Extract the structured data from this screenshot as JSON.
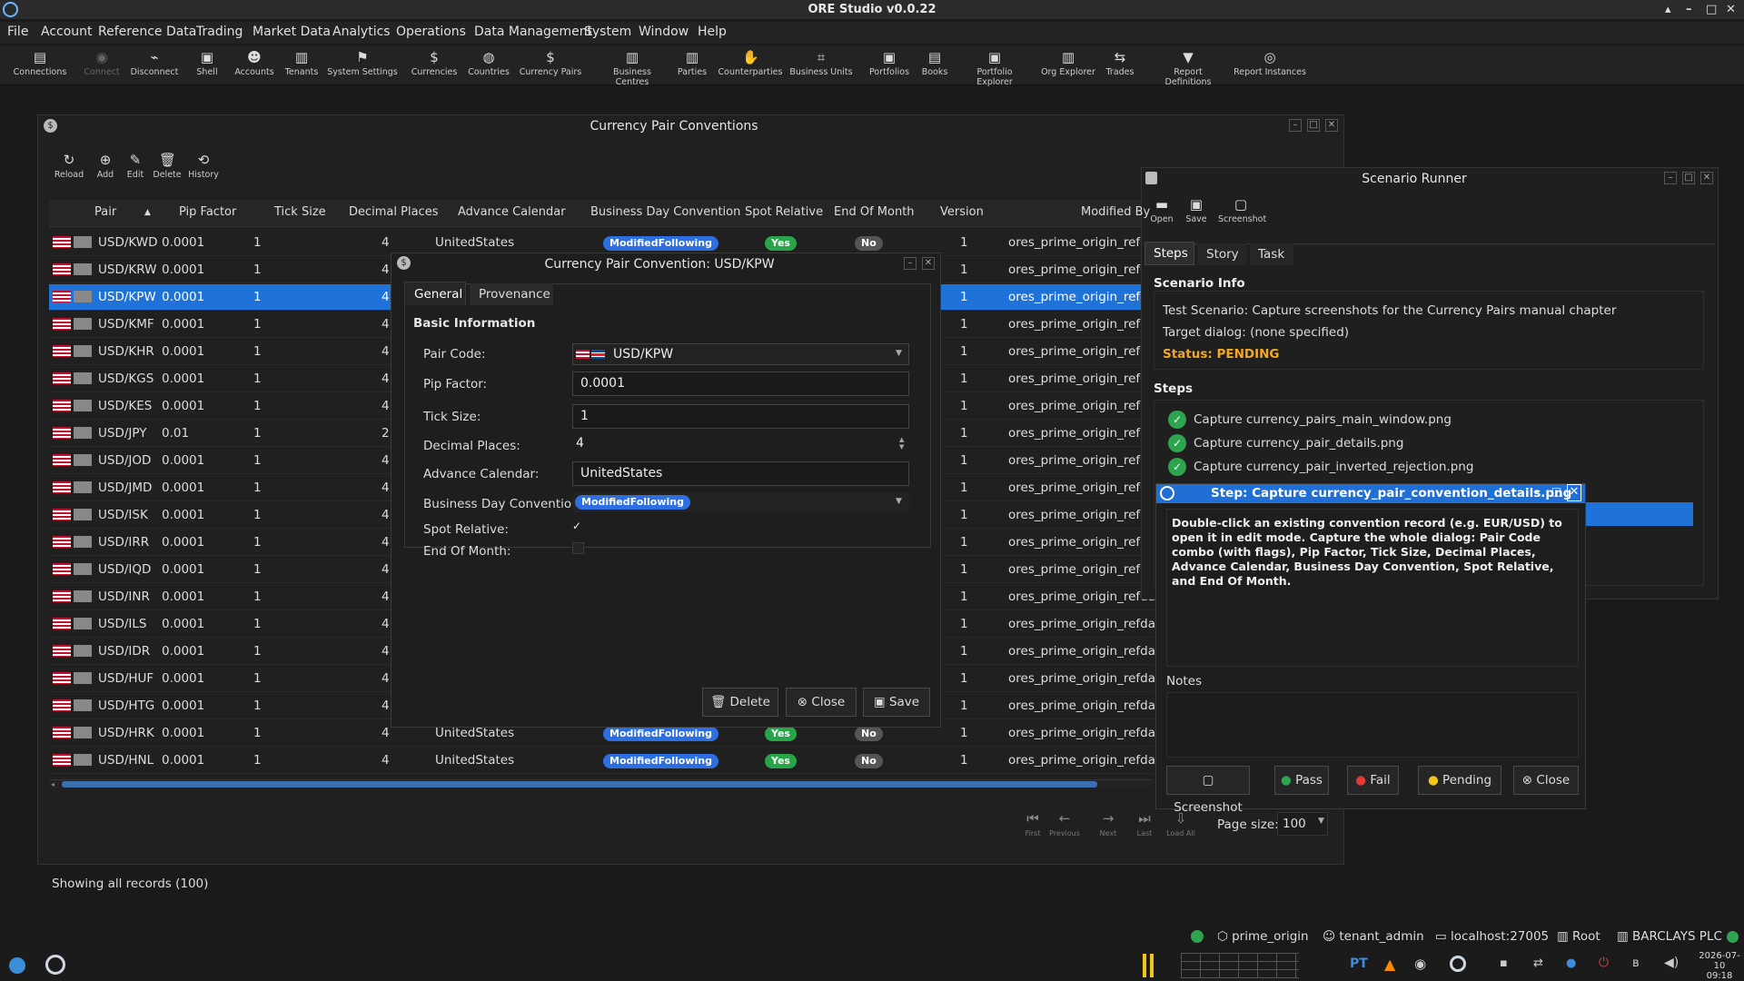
{
  "app": {
    "title": "ORE Studio v0.0.22"
  },
  "menu": [
    "File",
    "Account",
    "Reference Data",
    "Trading",
    "Market Data",
    "Analytics",
    "Operations",
    "Data Management",
    "System",
    "Window",
    "Help"
  ],
  "toolbar": [
    {
      "label": "Connections",
      "icon": "connections-icon"
    },
    {
      "label": "Connect",
      "icon": "connect-icon",
      "disabled": true
    },
    {
      "label": "Disconnect",
      "icon": "disconnect-icon"
    },
    {
      "label": "Shell",
      "icon": "shell-icon"
    },
    {
      "label": "Accounts",
      "icon": "accounts-icon"
    },
    {
      "label": "Tenants",
      "icon": "tenants-icon"
    },
    {
      "label": "System Settings",
      "icon": "flag-icon"
    },
    {
      "label": "Currencies",
      "icon": "dollar-icon"
    },
    {
      "label": "Countries",
      "icon": "globe-icon"
    },
    {
      "label": "Currency Pairs",
      "icon": "dollar-icon"
    },
    {
      "label": "Business Centres",
      "icon": "building-icon"
    },
    {
      "label": "Parties",
      "icon": "building-icon"
    },
    {
      "label": "Counterparties",
      "icon": "handshake-icon"
    },
    {
      "label": "Business Units",
      "icon": "units-icon"
    },
    {
      "label": "Portfolios",
      "icon": "briefcase-icon"
    },
    {
      "label": "Books",
      "icon": "book-icon"
    },
    {
      "label": "Portfolio Explorer",
      "icon": "briefcase-icon"
    },
    {
      "label": "Org Explorer",
      "icon": "org-icon"
    },
    {
      "label": "Trades",
      "icon": "trades-icon"
    },
    {
      "label": "Report Definitions",
      "icon": "report-icon"
    },
    {
      "label": "Report Instances",
      "icon": "report-instance-icon"
    }
  ],
  "cpc": {
    "title": "Currency Pair Conventions",
    "actions": [
      "Reload",
      "Add",
      "Edit",
      "Delete",
      "History"
    ],
    "columns": [
      "Pair",
      "Pip Factor",
      "Tick Size",
      "Decimal Places",
      "Advance Calendar",
      "Business Day Convention",
      "Spot Relative",
      "End Of Month",
      "Version",
      "Modified By"
    ],
    "rows": [
      {
        "pair": "USD/KWD",
        "pip": "0.0001",
        "tick": "1",
        "dp": "4",
        "cal": "UnitedStates",
        "bdc": "ModifiedFollowing",
        "spot": "Yes",
        "eom": "No",
        "ver": "1",
        "mod": "ores_prime_origin_refdata"
      },
      {
        "pair": "USD/KRW",
        "pip": "0.0001",
        "tick": "1",
        "dp": "4",
        "cal": "",
        "bdc": "",
        "spot": "",
        "eom": "",
        "ver": "1",
        "mod": "ores_prime_origin_refdata"
      },
      {
        "pair": "USD/KPW",
        "pip": "0.0001",
        "tick": "1",
        "dp": "4",
        "cal": "",
        "bdc": "",
        "spot": "",
        "eom": "",
        "ver": "1",
        "mod": "ores_prime_origin_refdata",
        "selected": true
      },
      {
        "pair": "USD/KMF",
        "pip": "0.0001",
        "tick": "1",
        "dp": "4",
        "cal": "",
        "bdc": "",
        "spot": "",
        "eom": "",
        "ver": "1",
        "mod": "ores_prime_origin_refdata"
      },
      {
        "pair": "USD/KHR",
        "pip": "0.0001",
        "tick": "1",
        "dp": "4",
        "cal": "",
        "bdc": "",
        "spot": "",
        "eom": "",
        "ver": "1",
        "mod": "ores_prime_origin_refdata"
      },
      {
        "pair": "USD/KGS",
        "pip": "0.0001",
        "tick": "1",
        "dp": "4",
        "cal": "",
        "bdc": "",
        "spot": "",
        "eom": "",
        "ver": "1",
        "mod": "ores_prime_origin_refdata"
      },
      {
        "pair": "USD/KES",
        "pip": "0.0001",
        "tick": "1",
        "dp": "4",
        "cal": "",
        "bdc": "",
        "spot": "",
        "eom": "",
        "ver": "1",
        "mod": "ores_prime_origin_refdata"
      },
      {
        "pair": "USD/JPY",
        "pip": "0.01",
        "tick": "1",
        "dp": "2",
        "cal": "",
        "bdc": "",
        "spot": "",
        "eom": "",
        "ver": "1",
        "mod": "ores_prime_origin_refdata"
      },
      {
        "pair": "USD/JOD",
        "pip": "0.0001",
        "tick": "1",
        "dp": "4",
        "cal": "",
        "bdc": "",
        "spot": "",
        "eom": "",
        "ver": "1",
        "mod": "ores_prime_origin_refdata"
      },
      {
        "pair": "USD/JMD",
        "pip": "0.0001",
        "tick": "1",
        "dp": "4",
        "cal": "",
        "bdc": "",
        "spot": "",
        "eom": "",
        "ver": "1",
        "mod": "ores_prime_origin_refdata"
      },
      {
        "pair": "USD/ISK",
        "pip": "0.0001",
        "tick": "1",
        "dp": "4",
        "cal": "",
        "bdc": "",
        "spot": "",
        "eom": "",
        "ver": "1",
        "mod": "ores_prime_origin_refdata"
      },
      {
        "pair": "USD/IRR",
        "pip": "0.0001",
        "tick": "1",
        "dp": "4",
        "cal": "",
        "bdc": "",
        "spot": "",
        "eom": "",
        "ver": "1",
        "mod": "ores_prime_origin_refdata"
      },
      {
        "pair": "USD/IQD",
        "pip": "0.0001",
        "tick": "1",
        "dp": "4",
        "cal": "",
        "bdc": "",
        "spot": "",
        "eom": "",
        "ver": "1",
        "mod": "ores_prime_origin_refdata"
      },
      {
        "pair": "USD/INR",
        "pip": "0.0001",
        "tick": "1",
        "dp": "4",
        "cal": "",
        "bdc": "",
        "spot": "",
        "eom": "",
        "ver": "1",
        "mod": "ores_prime_origin_refdata"
      },
      {
        "pair": "USD/ILS",
        "pip": "0.0001",
        "tick": "1",
        "dp": "4",
        "cal": "",
        "bdc": "",
        "spot": "",
        "eom": "",
        "ver": "1",
        "mod": "ores_prime_origin_refdata"
      },
      {
        "pair": "USD/IDR",
        "pip": "0.0001",
        "tick": "1",
        "dp": "4",
        "cal": "",
        "bdc": "",
        "spot": "",
        "eom": "",
        "ver": "1",
        "mod": "ores_prime_origin_refdata"
      },
      {
        "pair": "USD/HUF",
        "pip": "0.0001",
        "tick": "1",
        "dp": "4",
        "cal": "",
        "bdc": "",
        "spot": "",
        "eom": "",
        "ver": "1",
        "mod": "ores_prime_origin_refdata"
      },
      {
        "pair": "USD/HTG",
        "pip": "0.0001",
        "tick": "1",
        "dp": "4",
        "cal": "",
        "bdc": "",
        "spot": "",
        "eom": "",
        "ver": "1",
        "mod": "ores_prime_origin_refdata"
      },
      {
        "pair": "USD/HRK",
        "pip": "0.0001",
        "tick": "1",
        "dp": "4",
        "cal": "UnitedStates",
        "bdc": "ModifiedFollowing",
        "spot": "Yes",
        "eom": "No",
        "ver": "1",
        "mod": "ores_prime_origin_refdata"
      },
      {
        "pair": "USD/HNL",
        "pip": "0.0001",
        "tick": "1",
        "dp": "4",
        "cal": "UnitedStates",
        "bdc": "ModifiedFollowing",
        "spot": "Yes",
        "eom": "No",
        "ver": "1",
        "mod": "ores_prime_origin_refdata"
      }
    ],
    "status": "Showing all records (100)",
    "pager": [
      "First",
      "Previous",
      "Next",
      "Last",
      "Load All"
    ],
    "page_size_label": "Page size:",
    "page_size": "100"
  },
  "dialog": {
    "title": "Currency Pair Convention: USD/KPW",
    "tabs": [
      "General",
      "Provenance"
    ],
    "section": "Basic Information",
    "labels": {
      "pair": "Pair Code:",
      "pip": "Pip Factor:",
      "tick": "Tick Size:",
      "dp": "Decimal Places:",
      "cal": "Advance Calendar:",
      "bdc": "Business Day Convention:",
      "spot": "Spot Relative:",
      "eom": "End Of Month:"
    },
    "values": {
      "pair": "USD/KPW",
      "pip": "0.0001",
      "tick": "1",
      "dp": "4",
      "cal": "UnitedStates",
      "bdc": "ModifiedFollowing",
      "spot": true,
      "eom": false
    },
    "buttons": {
      "delete": "Delete",
      "close": "Close",
      "save": "Save"
    }
  },
  "scenario": {
    "title": "Scenario Runner",
    "actions": [
      "Open",
      "Save",
      "Screenshot"
    ],
    "tabs": [
      "Steps",
      "Story",
      "Task"
    ],
    "info_heading": "Scenario Info",
    "info_line1": "Test Scenario: Capture screenshots for the Currency Pairs manual chapter",
    "info_line2": "Target dialog: (none specified)",
    "status": "Status: PENDING",
    "steps_heading": "Steps",
    "steps": [
      "Capture currency_pairs_main_window.png",
      "Capture currency_pair_details.png",
      "Capture currency_pair_inverted_rejection.png"
    ]
  },
  "step": {
    "title": "Step: Capture currency_pair_convention_details.png",
    "instruction": "Double-click an existing convention record (e.g. EUR/USD) to open it in edit mode. Capture the whole dialog: Pair Code combo (with flags), Pip Factor, Tick Size, Decimal Places, Advance Calendar, Business Day Convention, Spot Relative, and End Of Month.",
    "notes_label": "Notes",
    "buttons": {
      "screenshot": "Screenshot",
      "pass": "Pass",
      "fail": "Fail",
      "pending": "Pending",
      "close": "Close"
    }
  },
  "statusbar": {
    "origin": "prime_origin",
    "user": "tenant_admin",
    "host": "localhost:27005",
    "root": "Root",
    "party": "BARCLAYS PLC"
  },
  "tray": {
    "lang": "PT",
    "date": "2026-07-10",
    "time": "09:18"
  }
}
